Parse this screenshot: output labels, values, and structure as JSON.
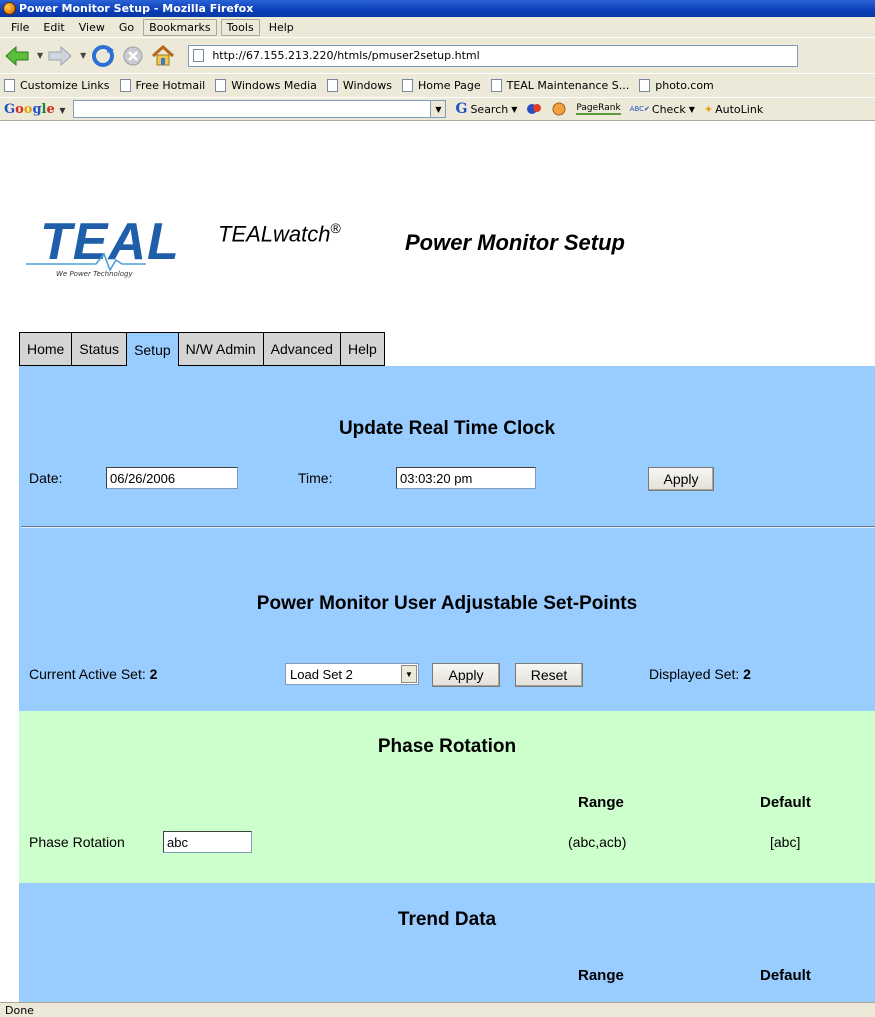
{
  "window": {
    "title": "Power Monitor Setup - Mozilla Firefox"
  },
  "menu": {
    "items": [
      "File",
      "Edit",
      "View",
      "Go",
      "Bookmarks",
      "Tools",
      "Help"
    ]
  },
  "navigation": {
    "url": "http://67.155.213.220/htmls/pmuser2setup.html"
  },
  "bookmarks": {
    "items": [
      "Customize Links",
      "Free Hotmail",
      "Windows Media",
      "Windows",
      "Home Page",
      "TEAL Maintenance S...",
      "photo.com"
    ]
  },
  "google_toolbar": {
    "search_value": "",
    "search_label": "Search",
    "pagerank_label": "PageRank",
    "check_label": "Check",
    "autolink_label": "AutoLink"
  },
  "header": {
    "logo_text": "TEAL",
    "tagline": "We Power Technology",
    "product": "TEALwatch",
    "registered": "®",
    "title": "Power Monitor Setup"
  },
  "tabs": [
    {
      "label": "Home",
      "active": false
    },
    {
      "label": "Status",
      "active": false
    },
    {
      "label": "Setup",
      "active": true
    },
    {
      "label": "N/W Admin",
      "active": false
    },
    {
      "label": "Advanced",
      "active": false
    },
    {
      "label": "Help",
      "active": false
    }
  ],
  "clock": {
    "title": "Update Real Time Clock",
    "date_label": "Date:",
    "date_value": "06/26/2006",
    "time_label": "Time:",
    "time_value": "03:03:20 pm",
    "apply_label": "Apply"
  },
  "setpoints": {
    "title": "Power Monitor User Adjustable Set-Points",
    "current_label": "Current Active Set:",
    "current_value": "2",
    "select_value": "Load Set 2",
    "apply_label": "Apply",
    "reset_label": "Reset",
    "displayed_label": "Displayed Set:",
    "displayed_value": "2"
  },
  "phase_rotation": {
    "title": "Phase Rotation",
    "range_header": "Range",
    "default_header": "Default",
    "field_label": "Phase Rotation",
    "field_value": "abc",
    "range_value": "(abc,acb)",
    "default_value": "[abc]"
  },
  "trend_data": {
    "title": "Trend Data",
    "range_header": "Range",
    "default_header": "Default"
  },
  "status": {
    "text": "Done"
  },
  "colors": {
    "blue_section": "#99ccff",
    "green_section": "#ccffcc",
    "teal_brand": "#1f5ea8"
  }
}
